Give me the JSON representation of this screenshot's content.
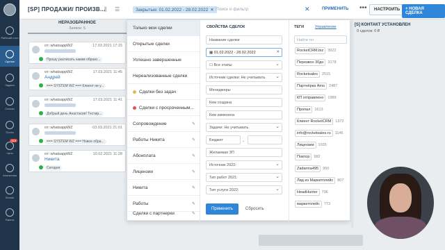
{
  "topbar": {
    "title": "[SP] ПРОДАЖИ/ ПРОИЗВ...",
    "filter_chip": "Закрытые: 01.02.2022 - 28.02.2022",
    "search_placeholder": "Поиск и фильтр",
    "apply_label": "ПРИМЕНИТЬ",
    "more_label": "•••",
    "setup_label": "НАСТРОИТЬ",
    "new_deal_label": "+ НОВАЯ СДЕЛКА"
  },
  "sidebar": {
    "items": [
      {
        "label": "Рабочий стол",
        "icon": "dashboard-icon"
      },
      {
        "label": "Сделки",
        "icon": "deals-icon"
      },
      {
        "label": "Задачи",
        "icon": "tasks-icon"
      },
      {
        "label": "Списки",
        "icon": "lists-icon"
      },
      {
        "label": "Почта",
        "icon": "mail-icon"
      },
      {
        "label": "Чаты",
        "icon": "chat-icon",
        "badge": "519"
      },
      {
        "label": "Аналитика",
        "icon": "analytics-icon"
      },
      {
        "label": "Sensei",
        "icon": "sensei-icon"
      },
      {
        "label": "Ракета",
        "icon": "rocket-icon"
      }
    ]
  },
  "column_left": {
    "title": "НЕРАЗОБРАННОЕ",
    "subtitle": "Заявок: 5"
  },
  "column_right": {
    "title": "[S] КОНТАКТ УСТАНОВЛЕН",
    "subtitle": "0 сделок: 0 ₽"
  },
  "cards": [
    {
      "from": "от: whatsappWZ",
      "date": "17.03.2021 17:15",
      "name": "",
      "message": "Прошу расписать каким образо..."
    },
    {
      "from": "от: whatsappWZ",
      "date": "17.03.2021 11:45",
      "name": "Андрей",
      "message": "=== SYSTEM WZ === Клиент не у..."
    },
    {
      "from": "от: whatsappWZ",
      "date": "17.03.2021 11:41",
      "name": "",
      "message": "Добрый день Анастасия! Тестир..."
    },
    {
      "from": "от: whatsappWZ",
      "date": "03.03.2021 21:01",
      "name": "",
      "message": "=== SYSTEM WZ === Новое обра..."
    },
    {
      "from": "от: whatsappWZ",
      "date": "10.02.2021 11:28",
      "name": "Никита",
      "message": "Сегодня"
    }
  ],
  "presets": [
    {
      "label": "Только мои сделки",
      "dot": "",
      "editable": false
    },
    {
      "label": "Открытые сделки",
      "dot": "",
      "editable": false
    },
    {
      "label": "Успешно завершенные",
      "dot": "",
      "editable": false
    },
    {
      "label": "Нереализованные сделки",
      "dot": "",
      "editable": false
    },
    {
      "label": "Сделки без задач",
      "dot": "#f0b24b",
      "editable": false
    },
    {
      "label": "Сделки с просроченным...",
      "dot": "#e0524a",
      "editable": false
    },
    {
      "label": "Сопровождение",
      "dot": "",
      "editable": true
    },
    {
      "label": "Работы Никита",
      "dot": "",
      "editable": true
    },
    {
      "label": "Абонплата",
      "dot": "",
      "editable": true
    },
    {
      "label": "Лицензии",
      "dot": "",
      "editable": true
    },
    {
      "label": "Никита",
      "dot": "",
      "editable": true
    },
    {
      "label": "Работы",
      "dot": "",
      "editable": true
    },
    {
      "label": "Сделки с партнерки",
      "dot": "",
      "editable": true
    }
  ],
  "properties": {
    "title": "СВОЙСТВА СДЕЛОК",
    "name_placeholder": "Название сделки",
    "date_value": "01.02.2022 - 28.02.2022",
    "stages_value": "Все этапы",
    "source_value": "Источник сделки: Не учитывать",
    "managers_value": "Менеджеры",
    "created_by_value": "Кем создана",
    "changed_by_value": "Кем изменена",
    "tasks_value": "Задачи: Не учитывать",
    "budget_value": "Бюджет",
    "budget_dash": "-",
    "desired_value": "Желаемая ЗП",
    "source2_value": "Источник 2022:",
    "work_type_value": "Тип работ 2021:",
    "service_type_value": "Тип услуги 2022:",
    "apply_label": "Применить",
    "reset_label": "Сбросить"
  },
  "tags": {
    "title": "ТЕГИ",
    "manage_label": "Управление",
    "search_placeholder": "Найти тег",
    "items": [
      {
        "name": "RocketCRM.biz",
        "count": "3922"
      },
      {
        "name": "Перезвон 30дн",
        "count": "3178"
      },
      {
        "name": "Rocketsales",
        "count": "2515"
      },
      {
        "name": "Партнёрка Amo",
        "count": "2487"
      },
      {
        "name": "КП отправлено",
        "count": "1989"
      },
      {
        "name": "Пропал",
        "count": "1613"
      },
      {
        "name": "Клиент RocketCRM",
        "count": "1372"
      },
      {
        "name": "info@rocketsales.ru",
        "count": "1146"
      },
      {
        "name": "Лицензии",
        "count": "1035"
      },
      {
        "name": "Повтор",
        "count": "982"
      },
      {
        "name": "Zadarma495",
        "count": "950"
      },
      {
        "name": "Лид из Маркетплейс",
        "count": "807"
      },
      {
        "name": "HeadHunter",
        "count": "796"
      },
      {
        "name": "маркетплейс",
        "count": "773"
      }
    ]
  }
}
